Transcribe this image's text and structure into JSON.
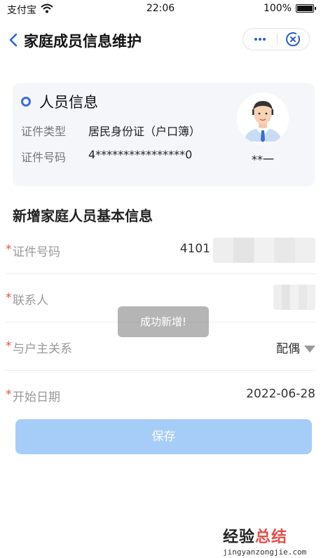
{
  "status_bar": {
    "carrier": "支付宝",
    "time": "22:06",
    "battery": "100%",
    "battery_level": 1.0
  },
  "nav": {
    "title": "家庭成员信息维护"
  },
  "person_card": {
    "title": "人员信息",
    "id_type_label": "证件类型",
    "id_type_value": "居民身份证（户口簿）",
    "id_number_label": "证件号码",
    "id_number_value": "4****************0",
    "name": "**一"
  },
  "form": {
    "section_title": "新增家庭人员基本信息",
    "required_mark": "*",
    "fields": [
      {
        "label": "证件号码",
        "value": "4101"
      },
      {
        "label": "联系人",
        "value": ""
      },
      {
        "label": "与户主关系",
        "value": "配偶"
      },
      {
        "label": "开始日期",
        "value": "2022-06-28"
      }
    ],
    "save_label": "保存"
  },
  "toast": "成功新增!",
  "watermark": {
    "text_a": "经验",
    "text_b": "总结",
    "url": "jingyanzongjie.com"
  },
  "colors": {
    "accent": "#3b6fd4",
    "required": "#e0514b",
    "button": "#a6cdf8"
  }
}
